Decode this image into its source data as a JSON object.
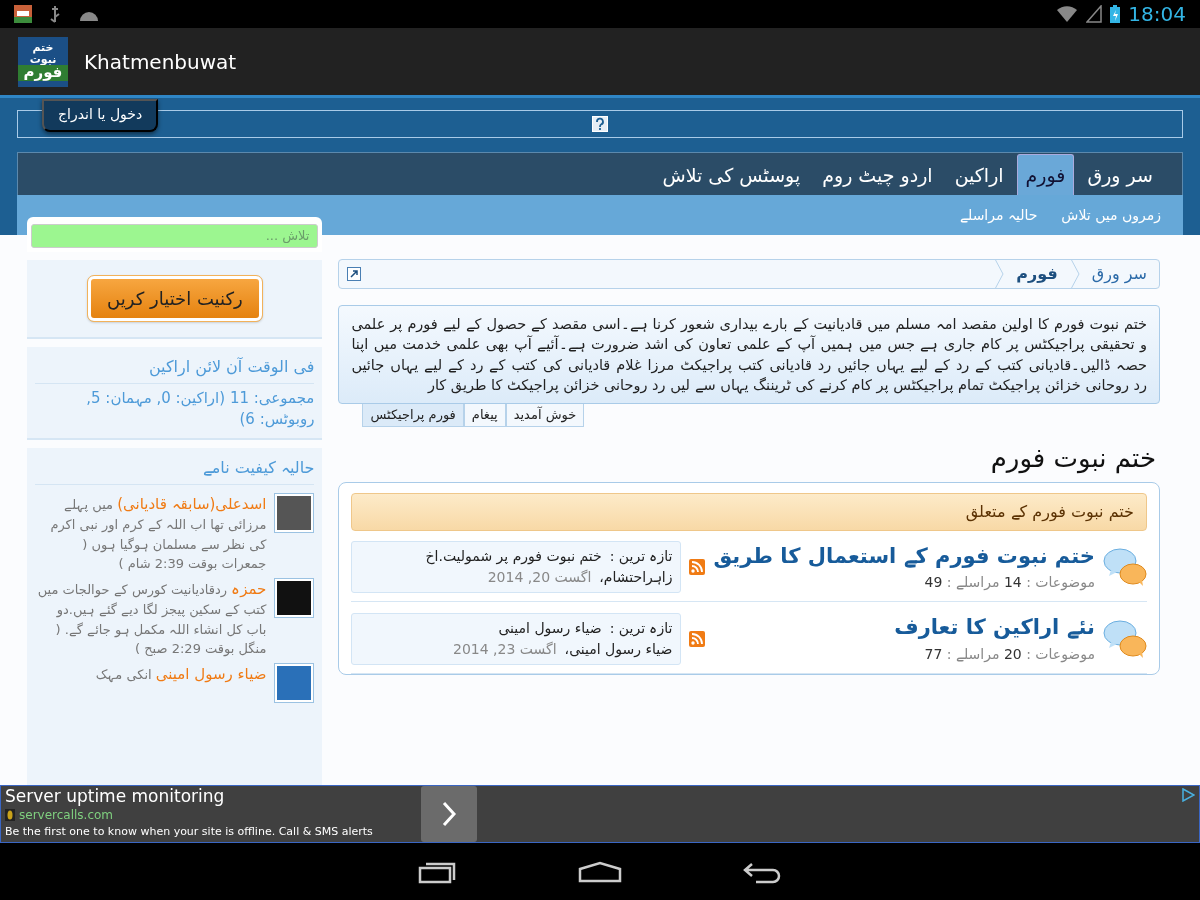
{
  "status_bar": {
    "time": "18:04"
  },
  "app_bar": {
    "logo_lines": [
      "ختم نبوت",
      "فورم"
    ],
    "title": "Khatmenbuwat"
  },
  "login_tab": "دخول یا اندراج",
  "nav_tabs": [
    {
      "label": "سر ورق",
      "selected": false
    },
    {
      "label": "فورم",
      "selected": true
    },
    {
      "label": "اراکین",
      "selected": false
    },
    {
      "label": "اردو چیٹ روم",
      "selected": false
    },
    {
      "label": "پوسٹس کی تلاش",
      "selected": false
    }
  ],
  "sub_nav": [
    "زمروں میں تلاش",
    "حالیہ مراسلے"
  ],
  "sidebar": {
    "search": {
      "placeholder": "تلاش ..."
    },
    "signup_button": "رکنیت اختیار کریں",
    "online": {
      "title": "فی الوقت آن لائن اراکین",
      "summary": "مجموعی: 11 (اراکین: 0, مہمان: 5, روبوٹس: 6)"
    },
    "statuses": {
      "title": "حالیہ کیفیت نامے",
      "items": [
        {
          "name": "اسدعلی(سابقہ قادیانی)",
          "text": "میں پہلے مرزائی تھا اب اللہ کے کرم اور نبی اکرم کی نظر سے مسلمان ہوگیا ہوں",
          "time": "( جمعرات بوقت 2:39 شام )"
        },
        {
          "name": "حمزہ",
          "text": "ردقادیانیت کورس کے حوالجات میں کتب کے سکین پیجز لگا دیے گئے ہیں.دو باب کل انشاء اللہ مکمل ہو جائے گے.",
          "time": "( منگل بوقت 2:29 صبح )"
        },
        {
          "name": "ضیاء رسول امینی",
          "text": "انکی مہک"
        }
      ]
    }
  },
  "breadcrumb": [
    "سر ورق",
    "فورم"
  ],
  "notice": {
    "segments": [
      {
        "kind": "text",
        "text": "ختم نبوت فورم کا اولین مقصد امہ مسلم میں قادیانیت کے بارے بیداری شعور کرنا ہے۔اسی مقصد کے حصول کے لیے فورم پر علمی و تحقیقی پراجیکٹس پر کام جاری ہے جس میں ہمیں آپ کے علمی تعاون کی اشد ضرورت ہے۔آئیے آپ بھی علمی خدمت میں اپنا حصہ ڈالیں۔قادیانی کتب کے رد کے لیے یہاں جائیں "
      },
      {
        "kind": "link",
        "text": "رد قادیانی کتب پراجیکٹ"
      },
      {
        "kind": "text",
        "text": " مرزا غلام قادیانی کی کتب کے رد کے لیے یہاں جائیں "
      },
      {
        "kind": "link",
        "text": "رد روحانی خزائن پراجیکٹ"
      },
      {
        "kind": "text",
        "text": " تمام پراجیکٹس پر کام کرنے کی ٹریننگ یہاں سے لیں "
      },
      {
        "kind": "link",
        "text": "رد روحانی خزائن پراجیکٹ کا طریق کار"
      }
    ],
    "tabs": [
      {
        "label": "خوش آمدید",
        "selected": false
      },
      {
        "label": "پیغام",
        "selected": false
      },
      {
        "label": "فورم پراجیکٹس",
        "selected": true
      }
    ]
  },
  "page_title": "ختم نبوت فورم",
  "category": {
    "title": "ختم نبوت فورم کے متعلق",
    "forums": [
      {
        "title": "ختم نبوت فورم کے استعمال کا طریق",
        "topics_label": "موضوعات :",
        "topics": "14",
        "posts_label": "مراسلے :",
        "posts": "49",
        "latest_label": "تازہ ترین :",
        "latest_title": "ختم نبوت فورم پر شمولیت.اخ",
        "latest_author": "زاہراحتشام،",
        "latest_date": "اگست 20, 2014"
      },
      {
        "title": "نئے اراکین کا تعارف",
        "topics_label": "موضوعات :",
        "topics": "20",
        "posts_label": "مراسلے :",
        "posts": "77",
        "latest_label": "تازہ ترین :",
        "latest_title": "ضیاء رسول امینی",
        "latest_author": "ضیاء رسول امینی،",
        "latest_date": "اگست 23, 2014"
      }
    ]
  },
  "ad": {
    "title": "Server uptime monitoring",
    "domain": "servercalls.com",
    "text": "Be the first one to know when your site is offline. Call & SMS alerts"
  }
}
